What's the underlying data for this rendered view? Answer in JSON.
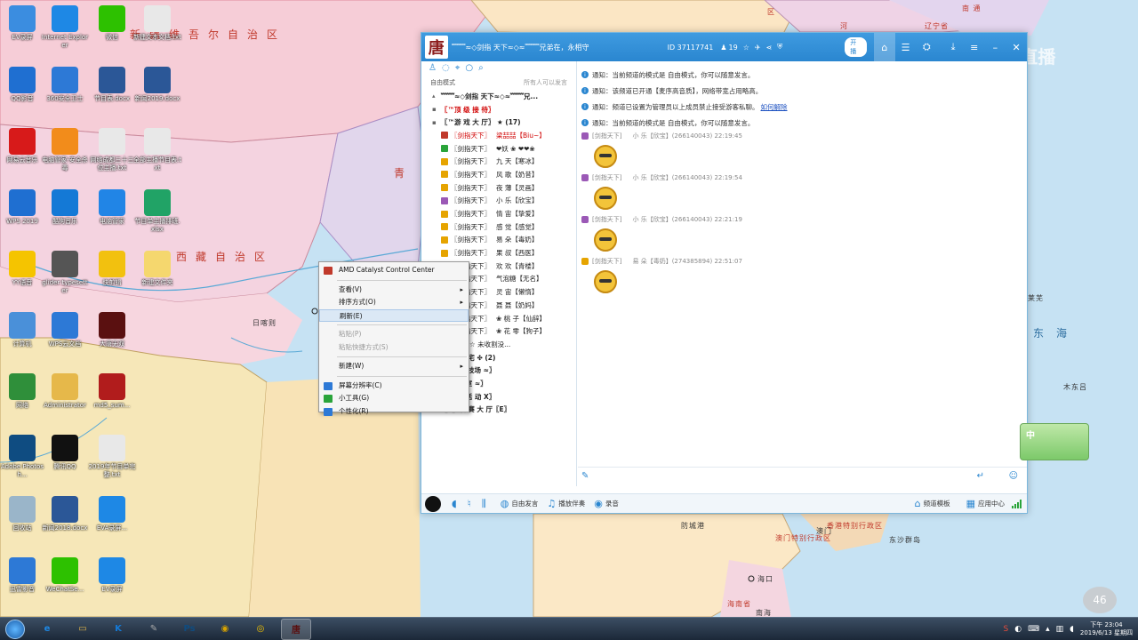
{
  "wallpaper": {
    "labels": [
      "新疆维吾尔自治区",
      "西藏自治区",
      "青",
      "东海",
      "日喀则",
      "南 通",
      "区",
      "河",
      "辽宁省",
      "防城港",
      "澳门",
      "香港特别行政区",
      "澳门特别行政区",
      "东沙群岛",
      "海口",
      "海南省",
      "南海",
      "莱芜",
      "木东吕"
    ],
    "overlay_brand": "CC直播"
  },
  "desktop_icons": [
    {
      "label": "EV录屏",
      "icon": "ev-icon",
      "color": "#3b8de0"
    },
    {
      "label": "Internet Explorer",
      "icon": "ie-icon",
      "color": "#1e88e5"
    },
    {
      "label": "微信",
      "icon": "wechat-icon",
      "color": "#2dc100"
    },
    {
      "label": "新建文本文档.txt",
      "icon": "txt-icon",
      "color": "#e8e8e8"
    },
    {
      "label": "QQ影音",
      "icon": "qqplayer-icon",
      "color": "#1f6fd1"
    },
    {
      "label": "360安全卫士",
      "icon": "shield-app-icon",
      "color": "#2d79d6"
    },
    {
      "label": "节目表.docx",
      "icon": "docx-icon",
      "color": "#2b5797"
    },
    {
      "label": "新闻2019.docx",
      "icon": "docx-icon",
      "color": "#2b5797"
    },
    {
      "label": "网易云音乐",
      "icon": "music-icon",
      "color": "#d71a1a"
    },
    {
      "label": "电脑管家-安全杀毒",
      "icon": "pcmgr-icon",
      "color": "#f28c1b"
    },
    {
      "label": "网络成都三十三位主播.txt",
      "icon": "txt-icon",
      "color": "#e8e8e8"
    },
    {
      "label": "全部主播节目表.txt",
      "icon": "txt-icon",
      "color": "#e8e8e8"
    },
    {
      "label": "WPS 2019",
      "icon": "wps-icon",
      "color": "#1f6fd1"
    },
    {
      "label": "酷狗音乐",
      "icon": "kugou-icon",
      "color": "#1479d6"
    },
    {
      "label": "电脑管家",
      "icon": "guard-icon",
      "color": "#2185e6"
    },
    {
      "label": "节目单主播排班.xlsx",
      "icon": "xlsx-icon",
      "color": "#21a366"
    },
    {
      "label": "YY语音",
      "icon": "yy-icon",
      "color": "#f5c400"
    },
    {
      "label": "glider typesetter",
      "icon": "pen-icon",
      "color": "#555555"
    },
    {
      "label": "快剪辑",
      "icon": "editor-icon",
      "color": "#f2c10f"
    },
    {
      "label": "新建文件夹",
      "icon": "folder-icon",
      "color": "#f5d76e"
    },
    {
      "label": "计算机",
      "icon": "computer-icon",
      "color": "#4a90d9"
    },
    {
      "label": "WPS云文档",
      "icon": "cloud-icon",
      "color": "#2d79d6"
    },
    {
      "label": "大唐无双",
      "icon": "tang-icon",
      "color": "#5a1010"
    },
    {
      "label": "网络",
      "icon": "network-icon",
      "color": "#2f8f3a"
    },
    {
      "label": "Administrator",
      "icon": "user-folder-icon",
      "color": "#e6b84a"
    },
    {
      "label": "md5_sum...",
      "icon": "md5-icon",
      "color": "#b11c1c"
    },
    {
      "label": "Adobe Photosh...",
      "icon": "ps-icon",
      "color": "#0f4c81"
    },
    {
      "label": "腾讯QQ",
      "icon": "qq-icon",
      "color": "#111111"
    },
    {
      "label": "2019年节目单完整.txt",
      "icon": "txt-icon",
      "color": "#e8e8e8"
    },
    {
      "label": "回收站",
      "icon": "recycle-icon",
      "color": "#9ab5c9"
    },
    {
      "label": "新闻2018.docx",
      "icon": "docx-icon",
      "color": "#2b5797"
    },
    {
      "label": "EVA录屏...",
      "icon": "eva-icon",
      "color": "#1e88e5"
    },
    {
      "label": "迅雷影音",
      "icon": "xunlei-icon",
      "color": "#2d79d6"
    },
    {
      "label": "WeChatSe...",
      "icon": "wechat-icon",
      "color": "#2dc100"
    },
    {
      "label": "EV录屏",
      "icon": "ev-icon",
      "color": "#1e88e5"
    }
  ],
  "chat": {
    "title": "﹌﹌≈◇剑指 天下≈◇≈﹌﹌兄弟在，永相守",
    "channel_id": "ID 37117741",
    "online": "19",
    "toggle": "开播",
    "left": {
      "mode": "自由模式",
      "mode_hint": "所有人可以发言",
      "channels": [
        {
          "name": "﹌﹌≈◇剑指 天下≈◇≈﹌﹌兄...",
          "red": false
        },
        {
          "name": "〖™顶 级 接 待〗",
          "red": true
        },
        {
          "name": "〖™游 戏 大 厅〗  ★ (17)",
          "red": false
        }
      ],
      "users": [
        {
          "tag": "〖剑指天下〗",
          "name": "梁喆喆【Biu~】",
          "red": true,
          "badge": "#c0392b"
        },
        {
          "tag": "〖剑指天下〗",
          "name": "❤妖 ❀ ❤❤❀",
          "red": false,
          "badge": "#2aa43a"
        },
        {
          "tag": "〖剑指天下〗",
          "name": "九 天【寒冰】",
          "red": false,
          "badge": "#e6a400"
        },
        {
          "tag": "〖剑指天下〗",
          "name": "风 歌【奶昔】",
          "red": false,
          "badge": "#e6a400"
        },
        {
          "tag": "〖剑指天下〗",
          "name": "夜 薄【灵画】",
          "red": false,
          "badge": "#e6a400"
        },
        {
          "tag": "〖剑指天下〗",
          "name": "小 乐【欣宝】",
          "red": false,
          "badge": "#9b59b6"
        },
        {
          "tag": "〖剑指天下〗",
          "name": "情 宙【挚爱】",
          "red": false,
          "badge": "#e6a400"
        },
        {
          "tag": "〖剑指天下〗",
          "name": "感 觉【感觉】",
          "red": false,
          "badge": "#e6a400"
        },
        {
          "tag": "〖剑指天下〗",
          "name": "易 朵【毒奶】",
          "red": false,
          "badge": "#e6a400"
        },
        {
          "tag": "〖剑指天下〗",
          "name": "果 叔【西医】",
          "red": false,
          "badge": "#e6a400"
        },
        {
          "tag": "〖剑指天下〗",
          "name": "欢 欢【青楼】",
          "red": false,
          "badge": "#e6a400"
        },
        {
          "tag": "〖剑指天下〗",
          "name": "气泡糖【无名】",
          "red": false,
          "badge": "#e6a400"
        },
        {
          "tag": "〖剑指天下〗",
          "name": "灵 宙【懒惰】",
          "red": false,
          "badge": "#e6a400"
        },
        {
          "tag": "〖剑指天下〗",
          "name": "聂 聂【奶妈】",
          "red": false,
          "badge": "#e6a400"
        },
        {
          "tag": "〖剑指天下〗",
          "name": "❀ 桃 子【仙辞】",
          "red": false,
          "badge": "#e6a400"
        },
        {
          "tag": "〖剑指天下〗",
          "name": "❀ 花 零【狗子】",
          "red": false,
          "badge": "#e6a400"
        },
        {
          "tag": "静渊",
          "name": "☆ 未收割没...",
          "red": false,
          "badge": "#e6a400"
        }
      ],
      "sub_channels": [
        "公 馆 雅 宅 ✤ (2)",
        "〖剑指竞技场 ≈〗",
        "〖会 议 室 ≈〗",
        "〖副 本 活 动 Ⅹ〗",
        "〖E〗联 赛 大 厅〖E〗"
      ]
    },
    "notices": [
      {
        "text": "通知：当前频道的模式是 自由模式，你可以随意发言。",
        "link": ""
      },
      {
        "text": "通知：该频道已开通【麦序高音质】，网络带宽占用略高。",
        "link": ""
      },
      {
        "text": "通知：频道已设置为管理员以上成员禁止接受游客私聊。",
        "link": "如何解除"
      },
      {
        "text": "通知：当前频道的模式是 自由模式，你可以随意发言。",
        "link": ""
      }
    ],
    "messages": [
      {
        "tag": "[剑指天下]",
        "sender": "小 乐【欣宝】(266140043) 22:19:45",
        "badge": "#9b59b6"
      },
      {
        "tag": "[剑指天下]",
        "sender": "小 乐【欣宝】(266140043) 22:19:54",
        "badge": "#9b59b6"
      },
      {
        "tag": "[剑指天下]",
        "sender": "小 乐【欣宝】(266140043) 22:21:19",
        "badge": "#9b59b6"
      },
      {
        "tag": "[剑指天下]",
        "sender": "易 朵【毒奶】(274385894) 22:51:07",
        "badge": "#e6a400"
      }
    ],
    "bottom": {
      "free_speech": "自由发言",
      "play_music": "播放伴奏",
      "record": "录音",
      "template": "频道模板",
      "app_center": "应用中心"
    }
  },
  "side_widget": {
    "label": "中"
  },
  "context_menu": {
    "items": [
      {
        "label": "AMD Catalyst Control Center",
        "icon": "amd-icon",
        "state": "normal",
        "submenu": false
      },
      {
        "sep": true
      },
      {
        "label": "查看(V)",
        "state": "normal",
        "submenu": true
      },
      {
        "label": "排序方式(O)",
        "state": "normal",
        "submenu": true
      },
      {
        "label": "刷新(E)",
        "state": "hover",
        "submenu": false
      },
      {
        "sep": true
      },
      {
        "label": "粘贴(P)",
        "state": "disabled",
        "submenu": false
      },
      {
        "label": "粘贴快捷方式(S)",
        "state": "disabled",
        "submenu": false
      },
      {
        "sep": true
      },
      {
        "label": "新建(W)",
        "state": "normal",
        "submenu": true
      },
      {
        "sep": true
      },
      {
        "label": "屏幕分辨率(C)",
        "icon": "screen-icon",
        "state": "normal",
        "submenu": false
      },
      {
        "label": "小工具(G)",
        "icon": "gadget-icon",
        "state": "normal",
        "submenu": false
      },
      {
        "label": "个性化(R)",
        "icon": "personalize-icon",
        "state": "normal",
        "submenu": false
      }
    ]
  },
  "taskbar": {
    "apps": [
      {
        "name": "ie-taskbar-icon",
        "glyph": "e",
        "color": "#1e88e5"
      },
      {
        "name": "explorer-taskbar-icon",
        "glyph": "▭",
        "color": "#e6b84a"
      },
      {
        "name": "kugou-taskbar-icon",
        "glyph": "K",
        "color": "#1479d6"
      },
      {
        "name": "pen-taskbar-icon",
        "glyph": "✎",
        "color": "#aaaaaa"
      },
      {
        "name": "photoshop-taskbar-icon",
        "glyph": "Ps",
        "color": "#0f4c81"
      },
      {
        "name": "chrome-taskbar-icon",
        "glyph": "◉",
        "color": "#d9a400"
      },
      {
        "name": "yy-taskbar-icon",
        "glyph": "◎",
        "color": "#f5c400"
      },
      {
        "name": "tang-taskbar-icon",
        "glyph": "唐",
        "color": "#5a1010",
        "active": true
      }
    ],
    "clock_time": "下午 23:04",
    "clock_date": "2019/6/13 星期四"
  },
  "overlay_badge": "46"
}
